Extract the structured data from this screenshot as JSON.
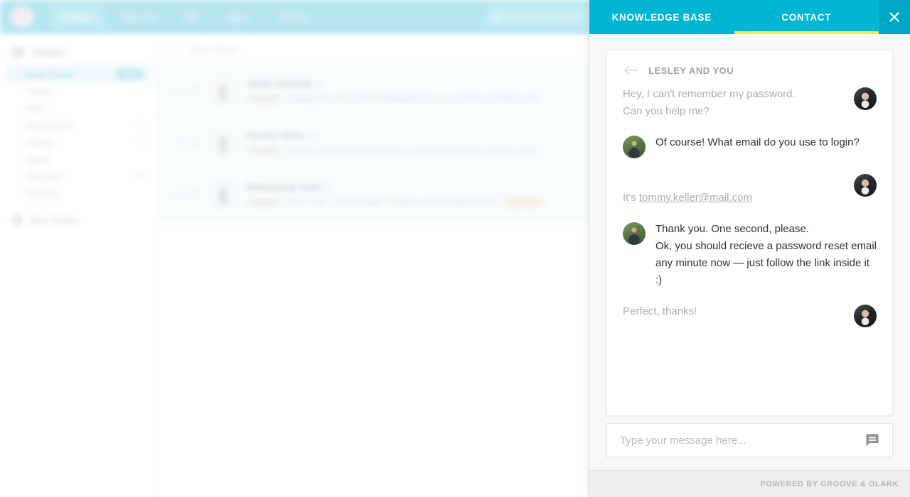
{
  "background_app": {
    "topbar": {
      "logo_icon": "app-logo-icon",
      "search": {
        "placeholder": "Search by keyword",
        "icon": "search-icon"
      },
      "nav": [
        {
          "label": "Tickets",
          "active": true
        },
        {
          "label": "Reports",
          "active": false
        },
        {
          "label": "KB",
          "active": false
        },
        {
          "label": "Apps",
          "active": false
        },
        {
          "label": "Admin",
          "active": false
        }
      ]
    },
    "sidebar": {
      "heading": "Tickets",
      "heading_icon": "inbox-icon",
      "items": [
        {
          "label": "New Ticket",
          "badge": "123",
          "selected": true
        },
        {
          "label": "Twitter",
          "badge": "",
          "selected": false
        },
        {
          "label": "Mine",
          "badge": "",
          "selected": false
        },
        {
          "label": "Developers",
          "badge": "1",
          "selected": false
        },
        {
          "label": "Clients",
          "badge": "3",
          "selected": false
        },
        {
          "label": "Spam",
          "badge": "",
          "selected": false
        },
        {
          "label": "Snoozed",
          "badge": "12",
          "selected": false
        },
        {
          "label": "Pending",
          "badge": "",
          "selected": false
        }
      ],
      "new_ticket_label": "New Ticket",
      "new_ticket_icon": "plus-circle-icon"
    },
    "main": {
      "header_label": "New tickets",
      "rows": [
        {
          "name": "Julian Nowicki",
          "id": "#1",
          "tag": "Support",
          "tag_amber": "",
          "preview": "suggestion Heya Ticket delegate! Can you set the workflows all"
        },
        {
          "name": "Florian Marty",
          "id": "#2",
          "tag": "Support",
          "tag_amber": "",
          "preview": "wrong customer shown Hello, in one of my tickets I have a cust"
        },
        {
          "name": "Rhiannaray Goel",
          "id": "#3",
          "tag": "Support",
          "tag_amber": "Sent from",
          "preview": "Fwd: 'Mac 11 Mainstage' mailbox shows 2489 emails"
        }
      ]
    }
  },
  "widget": {
    "tabs": [
      {
        "label": "KNOWLEDGE BASE",
        "active": false
      },
      {
        "label": "CONTACT",
        "active": true
      }
    ],
    "close_icon": "close-icon",
    "accent_color": "#00b6d4",
    "accent_dark_color": "#00a7c2",
    "tab_underline_color": "#edea60",
    "conversation": {
      "back_icon": "back-arrow-icon",
      "title": "LESLEY AND YOU",
      "messages": [
        {
          "from": "customer",
          "avatar": "customer-avatar",
          "text": "Hey, I can't remember my password.\nCan you help me?"
        },
        {
          "from": "agent",
          "avatar": "agent-avatar",
          "text": "Of course! What email do you use to login?"
        },
        {
          "from": "customer",
          "avatar": "customer-avatar",
          "text_before_link": "It's ",
          "link": "tommy.keller@mail.com",
          "text": ""
        },
        {
          "from": "agent",
          "avatar": "agent-avatar",
          "text": "Thank you. One second, please.\nOk, you should recieve a password reset email any minute now — just follow the link inside it :)"
        },
        {
          "from": "customer",
          "avatar": "customer-avatar",
          "text": "Perfect, thanks!"
        }
      ]
    },
    "composer": {
      "placeholder": "Type your message here...",
      "value": "",
      "send_icon": "chat-bubble-send-icon"
    },
    "footer": {
      "text": "POWERED BY GROOVE & OLARK"
    }
  }
}
